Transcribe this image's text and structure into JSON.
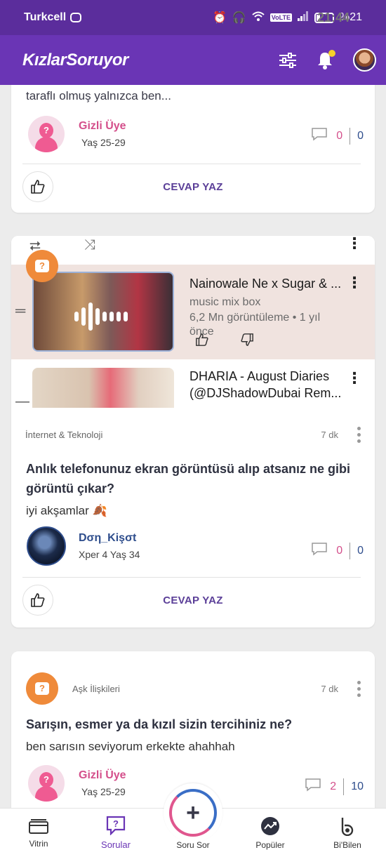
{
  "status_bar": {
    "carrier": "Turkcell",
    "time": "21:44",
    "battery": "%21",
    "volte": "VoLTE"
  },
  "app": {
    "logo": "KızlarSoruyor"
  },
  "cards": [
    {
      "snippet": "taraflı olmuş yalnızca ben...",
      "user_name": "Gizli Üye",
      "user_sub": "Yaş 25-29",
      "comments": "0",
      "views": "0",
      "reply_label": "CEVAP YAZ"
    },
    {
      "embed": {
        "video1_title": "Nainowale Ne x Sugar & ...",
        "video1_channel": "music mix box",
        "video1_meta": "6,2 Mn görüntüleme • 1 yıl",
        "video1_meta2": "önce",
        "video2_title": "DHARIA - August Diaries",
        "video2_title2": "(@DJShadowDubai Rem..."
      },
      "category": "İnternet & Teknoloji",
      "time": "7 dk",
      "title": "Anlık telefonunuz ekran görüntüsü alıp atsanız ne gibi görüntü çıkar?",
      "body": "iyi akşamlar 🍂",
      "user_name": "Dση_Kişσt",
      "user_sub": "Xper 4  Yaş 34",
      "comments": "0",
      "views": "0",
      "reply_label": "CEVAP YAZ"
    },
    {
      "category": "Aşk İlişkileri",
      "time": "7 dk",
      "title": "Sarışın, esmer ya da kızıl sizin tercihiniz ne?",
      "body": "ben sarısın seviyorum erkekte ahahhah",
      "user_name": "Gizli Üye",
      "user_sub": "Yaş 25-29",
      "comments": "2",
      "views": "10"
    }
  ],
  "bottom_nav": {
    "vitrin": "Vitrin",
    "sorular": "Sorular",
    "soru_sor": "Soru Sor",
    "populer": "Popüler",
    "bibilen": "Bi'Bilen"
  }
}
